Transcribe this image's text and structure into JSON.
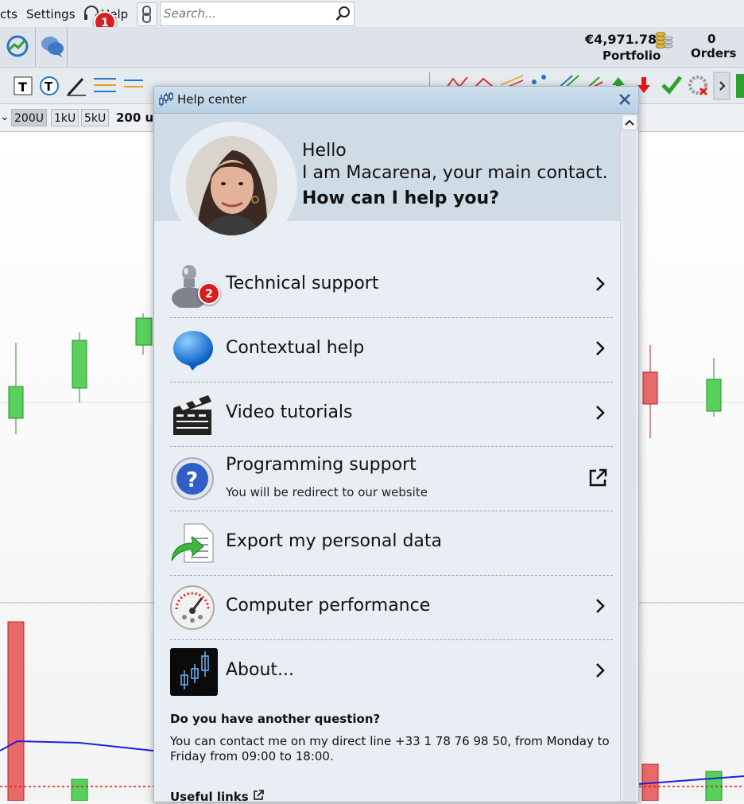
{
  "menubar": {
    "items": [
      "cts",
      "Settings",
      "Help"
    ],
    "search_placeholder": "Search...",
    "badge_1": "1"
  },
  "toolbar": {
    "portfolio_value": "€4,971.78",
    "portfolio_label": "Portfolio",
    "orders_count": "0",
    "orders_label": "Orders"
  },
  "quantity": {
    "buttons": [
      "200U",
      "1kU",
      "5kU"
    ],
    "selected": "200U",
    "current": "200 u"
  },
  "help_center": {
    "title": "Help center",
    "greeting_1": "Hello",
    "greeting_2": "I am Macarena, your main contact.",
    "greeting_3": "How can I help you?",
    "badge_2": "2",
    "items": [
      {
        "label": "Technical support",
        "icon": "user-support-icon",
        "action": "chevron"
      },
      {
        "label": "Contextual help",
        "icon": "speech-bubble-icon",
        "action": "chevron"
      },
      {
        "label": "Video tutorials",
        "icon": "clapperboard-icon",
        "action": "chevron"
      },
      {
        "label": "Programming support",
        "sublabel": "You will be redirect to our website",
        "icon": "question-icon",
        "action": "external-link"
      },
      {
        "label": "Export my personal data",
        "icon": "export-document-icon",
        "action": "none"
      },
      {
        "label": "Computer performance",
        "icon": "speedometer-icon",
        "action": "chevron"
      },
      {
        "label": "About...",
        "icon": "candlestick-logo-icon",
        "action": "chevron"
      }
    ],
    "question_heading": "Do you have another question?",
    "question_text": "You can contact me on my direct line +33 1 78 76 98 50, from Monday to Friday from 09:00 to 18:00.",
    "useful_links": "Useful links"
  },
  "colors": {
    "accent_red": "#d81e1e",
    "candle_green": "#58d05c",
    "candle_red": "#e86a6a",
    "panel_bg": "#e8eef3"
  }
}
